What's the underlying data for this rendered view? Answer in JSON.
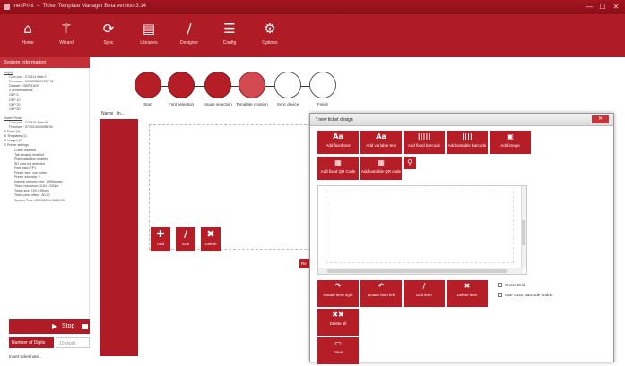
{
  "window": {
    "app_name": "InesPrint",
    "title": "Ticket Template Manager Beta version 3.14"
  },
  "window_controls": [
    "—",
    "☐",
    "✕"
  ],
  "ribbon": {
    "items": [
      {
        "label": "Home",
        "icon": "home-icon",
        "glyph": "⌂"
      },
      {
        "label": "Wizard",
        "icon": "wand-icon",
        "glyph": "⚚"
      },
      {
        "label": "Sync",
        "icon": "sync-icon",
        "glyph": "⟳"
      },
      {
        "label": "Libraries",
        "icon": "briefcase-icon",
        "glyph": "▤"
      },
      {
        "label": "Designer",
        "icon": "pencil-icon",
        "glyph": "∕"
      },
      {
        "label": "Config",
        "icon": "config-icon",
        "glyph": "☰"
      },
      {
        "label": "Options",
        "icon": "gear-icon",
        "glyph": "⚙"
      }
    ]
  },
  "system_info": {
    "header": "System Information",
    "lines": [
      {
        "text": "Ink(s)6",
        "cls": "sec"
      },
      {
        "text": "Com port : COM14 Addr:0",
        "cls": "ind"
      },
      {
        "text": "Firmware : NVDD06201TOP02",
        "cls": "ind"
      },
      {
        "text": "Dataset : GBP1160X",
        "cls": "ind"
      },
      {
        "text": "4 denominations",
        "cls": "ind"
      },
      {
        "text": "GBP 5",
        "cls": "ind"
      },
      {
        "text": "GBP 10",
        "cls": "ind"
      },
      {
        "text": "GBP 20",
        "cls": "ind"
      },
      {
        "text": "GBP 50",
        "cls": "ind"
      },
      {
        "text": "",
        "cls": "gap"
      },
      {
        "text": "Ticket Printer",
        "cls": "sec"
      },
      {
        "text": "Com port : COM15 Addr:64",
        "cls": "ind"
      },
      {
        "text": "Firmware : 57300100000BP40",
        "cls": "ind"
      },
      {
        "text": "⊞  Fonts (9)",
        "cls": ""
      },
      {
        "text": "⊞  Templates (1)",
        "cls": ""
      },
      {
        "text": "⊞  Images (7)",
        "cls": ""
      },
      {
        "text": "⊟  Printer settings",
        "cls": ""
      },
      {
        "text": "Cutter disabled",
        "cls": "ind2"
      },
      {
        "text": "Tab sensing enabled",
        "cls": "ind2"
      },
      {
        "text": "Plain validation enabled",
        "cls": "ind2"
      },
      {
        "text": "SD card not detected",
        "cls": "ind2"
      },
      {
        "text": "Font pack: TP1",
        "cls": "ind2"
      },
      {
        "text": "Printer type: non cutter",
        "cls": "ind2"
      },
      {
        "text": "Printer intensity: 2",
        "cls": "ind2"
      },
      {
        "text": "Internal memory free: 1999kbytes",
        "cls": "ind2"
      },
      {
        "text": "Ticket resolution: 1154 x 520px",
        "cls": "ind2"
      },
      {
        "text": "Ticket size: 190 x 65mm",
        "cls": "ind2"
      },
      {
        "text": "Ticket pixel offset : 80,20",
        "cls": "ind2"
      },
      {
        "text": "System Time: 23/04/2014 08:20:39",
        "cls": "ind2"
      }
    ]
  },
  "controls": {
    "play_glyph": "▶",
    "stop_label": "Stop",
    "digits_button": "Number of Digits",
    "digits_placeholder": "10 digits",
    "status_text": "Insert ticket/note..."
  },
  "wizard_steps": [
    {
      "label": "Start",
      "state": "done"
    },
    {
      "label": "Font selection",
      "state": "done"
    },
    {
      "label": "Image selection",
      "state": "done"
    },
    {
      "label": "Template creation",
      "state": "current"
    },
    {
      "label": "Sync device",
      "state": "todo"
    },
    {
      "label": "Finish",
      "state": "todo"
    }
  ],
  "ticket_list": {
    "columns": [
      "Name",
      "In..."
    ],
    "actions": [
      {
        "label": "Add",
        "glyph": "✚",
        "icon": "add-icon"
      },
      {
        "label": "Edit",
        "glyph": "∕",
        "icon": "pencil-icon"
      },
      {
        "label": "Delete",
        "glyph": "✖",
        "icon": "delete-icon"
      }
    ],
    "partial_button": "Re"
  },
  "dialog": {
    "title": "* new ticket design",
    "close_glyph": "✕",
    "add_buttons": [
      {
        "label": "Add fixed text",
        "glyph": "Aa",
        "icon": "text-icon"
      },
      {
        "label": "Add variable text",
        "glyph": "Aa",
        "icon": "variable-text-icon"
      },
      {
        "label": "Add fixed barcode",
        "glyph": "|||||",
        "icon": "barcode-icon"
      },
      {
        "label": "Add variable barcode",
        "glyph": "||||",
        "icon": "variable-barcode-icon"
      },
      {
        "label": "Add image",
        "glyph": "▣",
        "icon": "image-icon"
      },
      {
        "label": "Add fixed QR Code",
        "glyph": "▦",
        "icon": "qr-icon"
      },
      {
        "label": "Add variable QR code",
        "glyph": "▦",
        "icon": "variable-qr-icon"
      },
      {
        "label": "",
        "glyph": "⚲",
        "icon": "search-icon"
      }
    ],
    "item_buttons": [
      {
        "label": "Rotate item right",
        "glyph": "↷",
        "icon": "rotate-right-icon"
      },
      {
        "label": "Rotate item left",
        "glyph": "↶",
        "icon": "rotate-left-icon"
      },
      {
        "label": "Edit item",
        "glyph": "∕",
        "icon": "edit-icon"
      },
      {
        "label": "Delete item",
        "glyph": "✖",
        "icon": "delete-icon"
      },
      {
        "label": "Delete all",
        "glyph": "✖✖",
        "icon": "delete-all-icon"
      },
      {
        "label": "Save",
        "glyph": "▭",
        "icon": "save-icon"
      }
    ],
    "checkboxes": [
      {
        "label": "Show Grid",
        "checked": false
      },
      {
        "label": "Use GDS Barcode Guide",
        "checked": false
      }
    ]
  },
  "colors": {
    "brand": "#b01c25",
    "accent": "#d24b53"
  }
}
